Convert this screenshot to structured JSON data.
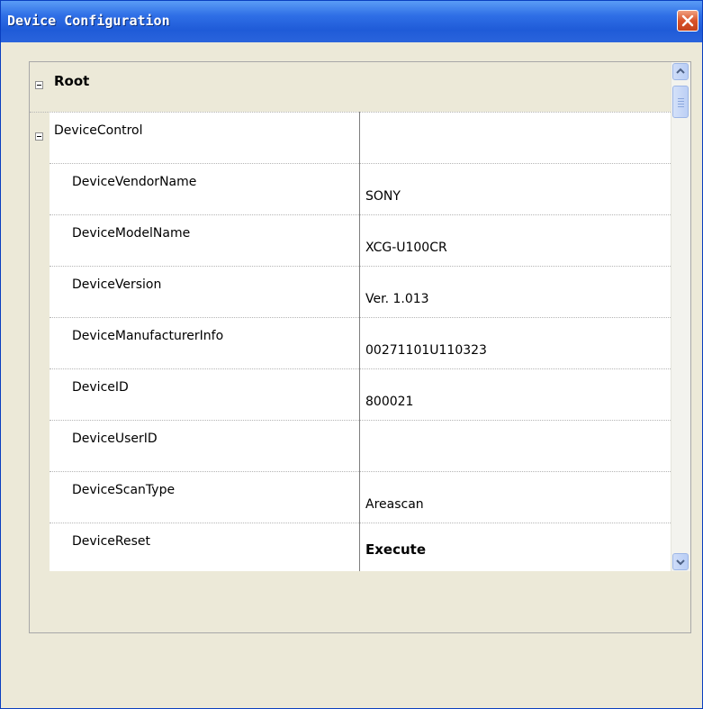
{
  "window": {
    "title": "Device Configuration"
  },
  "tree": {
    "root_label": "Root",
    "category": "DeviceControl",
    "properties": [
      {
        "name": "DeviceVendorName",
        "value": "SONY",
        "bold": false
      },
      {
        "name": "DeviceModelName",
        "value": "XCG-U100CR",
        "bold": false
      },
      {
        "name": "DeviceVersion",
        "value": "Ver. 1.013",
        "bold": false
      },
      {
        "name": "DeviceManufacturerInfo",
        "value": "00271101U110323",
        "bold": false
      },
      {
        "name": "DeviceID",
        "value": "800021",
        "bold": false
      },
      {
        "name": "DeviceUserID",
        "value": "",
        "bold": false
      },
      {
        "name": "DeviceScanType",
        "value": "Areascan",
        "bold": false
      },
      {
        "name": "DeviceReset",
        "value": "Execute",
        "bold": true
      }
    ]
  },
  "description": {
    "text": ""
  },
  "icons": {
    "close": "close-icon",
    "collapse": "collapse-icon",
    "scroll_up": "chevron-up-icon",
    "scroll_down": "chevron-down-icon"
  },
  "colors": {
    "titlebar": "#2f6fe6",
    "close_button": "#d9532a",
    "panel": "#ece9d8"
  }
}
